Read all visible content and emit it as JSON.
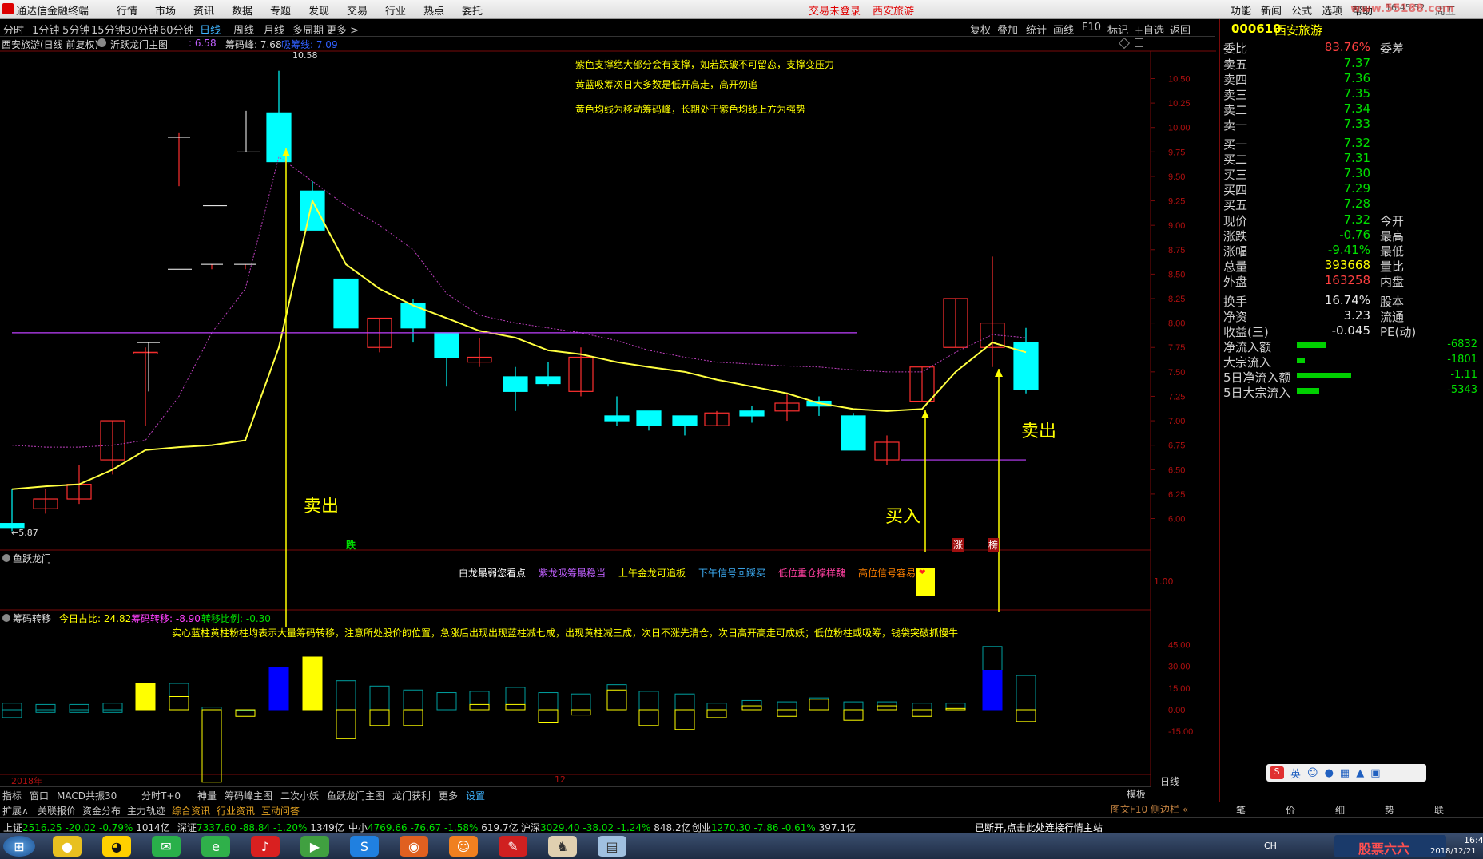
{
  "titlebar": {
    "app_name": "通达信金融终端",
    "menu": [
      "行情",
      "市场",
      "资讯",
      "数据",
      "专题",
      "发现",
      "交易",
      "行业",
      "热点",
      "委托"
    ],
    "trade_status": "交易未登录",
    "stock_name": "西安旅游",
    "right_menu": [
      "功能",
      "新闻",
      "公式",
      "选项",
      "帮助"
    ],
    "clock": "16:45:52",
    "weekday": "周五",
    "watermark": "www.55188.com"
  },
  "periods": [
    "分时",
    "1分钟",
    "5分钟",
    "15分钟",
    "30分钟",
    "60分钟",
    "日线",
    "周线",
    "月线",
    "多周期",
    "更多 >"
  ],
  "selected_period": "日线",
  "toolbar_right": [
    "复权",
    "叠加",
    "统计",
    "画线",
    "F10",
    "标记",
    "+自选",
    "返回"
  ],
  "chart_header": {
    "title": "西安旅游(日线 前复权)",
    "indicator": "沂跃龙门主图",
    "v1": ": 6.58",
    "v2_label": "筹码峰: 7.68",
    "v3_label": "吸筹线: 7.09"
  },
  "notes": [
    "紫色支撑绝大部分会有支撑，如若跌破不可留恋，支撑变压力",
    "黄蓝吸筹次日大多数是低开高走，高开勿追",
    "黄色均线为移动筹码峰，长期处于紫色均线上方为强势"
  ],
  "peak_label": "10.58",
  "low_label": "←5.87",
  "y_axis_main": [
    "10.50",
    "10.25",
    "10.00",
    "9.75",
    "9.50",
    "9.25",
    "9.00",
    "8.75",
    "8.50",
    "8.25",
    "8.00",
    "7.75",
    "7.50",
    "7.25",
    "7.00",
    "6.75",
    "6.50",
    "6.25",
    "6.00"
  ],
  "arrows": {
    "sell1": "卖出",
    "buy": "买入",
    "sell2": "卖出"
  },
  "mark_die": "跌",
  "mark_zhang": "涨",
  "mark_fang": "榜",
  "sub1": {
    "title": "鱼跃龙门",
    "legend": [
      {
        "text": "白龙最弱您看点",
        "color": "#ffffff"
      },
      {
        "text": "紫龙吸筹最稳当",
        "color": "#c060ff"
      },
      {
        "text": "上午金龙可追板",
        "color": "#ffff00"
      },
      {
        "text": "下午信号回踩买",
        "color": "#3fb4ff"
      },
      {
        "text": "低位重仓撑样魏",
        "color": "#ff40a0"
      },
      {
        "text": "高位信号容易",
        "color": "#ff8000"
      }
    ],
    "axis": "1.00"
  },
  "sub2": {
    "title": "筹码转移",
    "today_ratio": "今日占比: 24.82",
    "transfer": "筹码转移: -8.90",
    "transfer_ratio": "转移比例: -0.30",
    "note": "实心蓝柱黄柱粉柱均表示大量筹码转移，注意所处股价的位置，急涨后出现出现蓝柱减七成，出现黄柱减三成，次日不涨先清仓，次日高开高走可成妖；低位粉柱或吸筹，钱袋突破抓慢牛",
    "axis": [
      "45.00",
      "30.00",
      "15.00",
      "0.00",
      "-15.00"
    ]
  },
  "time_axis": {
    "year": "2018年",
    "month": "12"
  },
  "bottom_tabs": [
    "指标",
    "窗口",
    "MACD共振30",
    "分时T+0",
    "神量",
    "筹码峰主图",
    "二次小妖",
    "鱼跃龙门主图",
    "龙门获利",
    "更多",
    "设置"
  ],
  "bottom_tabs2": [
    "扩展∧",
    "关联报价",
    "资金分布",
    "主力轨迹",
    "综合资讯",
    "行业资讯",
    "互动问答"
  ],
  "right_bottom": {
    "board": "模板",
    "day": "日线",
    "f10": "图文F10",
    "side": "侧边栏 «"
  },
  "quote": {
    "code": "000610",
    "name": "西安旅游",
    "weibi_label": "委比",
    "weibi": "83.76%",
    "weicha_label": "委差",
    "sells": [
      {
        "label": "卖五",
        "price": "7.37"
      },
      {
        "label": "卖四",
        "price": "7.36"
      },
      {
        "label": "卖三",
        "price": "7.35"
      },
      {
        "label": "卖二",
        "price": "7.34"
      },
      {
        "label": "卖一",
        "price": "7.33"
      }
    ],
    "buys": [
      {
        "label": "买一",
        "price": "7.32"
      },
      {
        "label": "买二",
        "price": "7.31"
      },
      {
        "label": "买三",
        "price": "7.30"
      },
      {
        "label": "买四",
        "price": "7.29"
      },
      {
        "label": "买五",
        "price": "7.28"
      }
    ],
    "stats": [
      {
        "l": "现价",
        "v": "7.32",
        "c": "g",
        "l2": "今开"
      },
      {
        "l": "涨跌",
        "v": "-0.76",
        "c": "g",
        "l2": "最高"
      },
      {
        "l": "涨幅",
        "v": "-9.41%",
        "c": "g",
        "l2": "最低"
      },
      {
        "l": "总量",
        "v": "393668",
        "c": "y",
        "l2": "量比"
      },
      {
        "l": "外盘",
        "v": "163258",
        "c": "r",
        "l2": "内盘"
      },
      {
        "l": "换手",
        "v": "16.74%",
        "c": "w",
        "l2": "股本"
      },
      {
        "l": "净资",
        "v": "3.23",
        "c": "w",
        "l2": "流通"
      },
      {
        "l": "收益(三)",
        "v": "-0.045",
        "c": "w",
        "l2": "PE(动)"
      }
    ],
    "flows": [
      {
        "l": "净流入额",
        "v": "-6832",
        "bar": 0.45
      },
      {
        "l": "大宗流入",
        "v": "-1801",
        "bar": 0.12
      },
      {
        "l": "5日净流入额",
        "v": "-1.11",
        "bar": 0.85
      },
      {
        "l": "5日大宗流入",
        "v": "-5343",
        "bar": 0.35
      }
    ],
    "tabs": [
      "笔",
      "价",
      "细",
      "势",
      "联"
    ]
  },
  "status": {
    "items": [
      {
        "name": "上证",
        "val": "2516.25",
        "chg": "-20.02",
        "pct": "-0.79%",
        "amt": "1014亿"
      },
      {
        "name": "深证",
        "val": "7337.60",
        "chg": "-88.84",
        "pct": "-1.20%",
        "amt": "1349亿"
      },
      {
        "name": "中小",
        "val": "4769.66",
        "chg": "-76.67",
        "pct": "-1.58%",
        "amt": "619.7亿"
      },
      {
        "name": "沪深",
        "val": "3029.40",
        "chg": "-38.02",
        "pct": "-1.24%",
        "amt": "848.2亿"
      },
      {
        "name": "创业",
        "val": "1270.30",
        "chg": "-7.86",
        "pct": "-0.61%",
        "amt": "397.1亿"
      }
    ],
    "msg": "已断开,点击此处连接行情主站"
  },
  "taskbar": {
    "ime": "CH",
    "date": "2018/12/21",
    "time": "16:4",
    "brand": "股票六六"
  },
  "chart_data": {
    "type": "candlestick",
    "ylim": [
      5.8,
      10.7
    ],
    "candles": [
      {
        "o": 5.95,
        "c": 5.9,
        "h": 6.3,
        "l": 5.87
      },
      {
        "o": 6.1,
        "c": 6.2,
        "h": 6.3,
        "l": 6.05
      },
      {
        "o": 6.2,
        "c": 6.35,
        "h": 6.55,
        "l": 6.15
      },
      {
        "o": 6.6,
        "c": 7.0,
        "h": 7.0,
        "l": 6.45
      },
      {
        "o": 7.7,
        "c": 7.7,
        "h": 7.75,
        "l": 6.95
      },
      {
        "o": 9.9,
        "c": 9.9,
        "h": 9.95,
        "l": 9.4
      },
      {
        "o": 8.6,
        "c": 8.6,
        "h": 8.6,
        "l": 8.55
      },
      {
        "o": 8.6,
        "c": 8.6,
        "h": 8.6,
        "l": 8.55
      },
      {
        "o": 10.15,
        "c": 9.65,
        "h": 10.58,
        "l": 9.65
      },
      {
        "o": 9.35,
        "c": 8.95,
        "h": 9.45,
        "l": 8.95
      },
      {
        "o": 8.45,
        "c": 7.95,
        "h": 8.45,
        "l": 7.95
      },
      {
        "o": 7.75,
        "c": 8.05,
        "h": 8.05,
        "l": 7.7
      },
      {
        "o": 8.2,
        "c": 7.95,
        "h": 8.25,
        "l": 7.8
      },
      {
        "o": 7.9,
        "c": 7.65,
        "h": 7.9,
        "l": 7.35
      },
      {
        "o": 7.6,
        "c": 7.65,
        "h": 7.85,
        "l": 7.55
      },
      {
        "o": 7.45,
        "c": 7.3,
        "h": 7.55,
        "l": 7.1
      },
      {
        "o": 7.45,
        "c": 7.38,
        "h": 7.6,
        "l": 7.35
      },
      {
        "o": 7.3,
        "c": 7.65,
        "h": 7.75,
        "l": 7.25
      },
      {
        "o": 7.05,
        "c": 7.0,
        "h": 7.25,
        "l": 6.95
      },
      {
        "o": 7.1,
        "c": 6.95,
        "h": 7.1,
        "l": 6.9
      },
      {
        "o": 7.05,
        "c": 6.95,
        "h": 7.05,
        "l": 6.85
      },
      {
        "o": 6.95,
        "c": 7.08,
        "h": 7.1,
        "l": 6.95
      },
      {
        "o": 7.1,
        "c": 7.05,
        "h": 7.15,
        "l": 6.98
      },
      {
        "o": 7.1,
        "c": 7.18,
        "h": 7.28,
        "l": 7.0
      },
      {
        "o": 7.2,
        "c": 7.15,
        "h": 7.25,
        "l": 7.05
      },
      {
        "o": 7.05,
        "c": 6.7,
        "h": 7.08,
        "l": 6.7
      },
      {
        "o": 6.6,
        "c": 6.78,
        "h": 6.85,
        "l": 6.55
      },
      {
        "o": 7.2,
        "c": 7.55,
        "h": 7.55,
        "l": 7.2
      },
      {
        "o": 7.75,
        "c": 8.25,
        "h": 8.25,
        "l": 7.75
      },
      {
        "o": 7.75,
        "c": 8.0,
        "h": 8.68,
        "l": 7.55
      },
      {
        "o": 7.8,
        "c": 7.32,
        "h": 7.95,
        "l": 7.28
      }
    ],
    "volume_bars": [
      4,
      -5,
      3,
      -3,
      2,
      2,
      5,
      -2,
      22,
      20,
      5,
      -15,
      12,
      25,
      -10,
      15,
      -35,
      0,
      -10,
      24,
      -20,
      17,
      -10,
      12,
      5,
      5,
      14,
      -10,
      3,
      14,
      -8,
      8,
      -15,
      9,
      7,
      12,
      -20,
      5,
      5,
      5,
      0,
      45,
      45,
      25,
      -10
    ]
  }
}
